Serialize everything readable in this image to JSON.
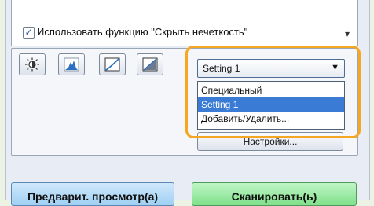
{
  "options": {
    "unsharp_mask_label": "Использовать функцию \"Скрыть нечеткость\"",
    "unsharp_mask_checked": true,
    "check_glyph": "✓",
    "scroll_arrow": "▾"
  },
  "tool_buttons": [
    {
      "icon": "brightness-icon"
    },
    {
      "icon": "histogram-icon"
    },
    {
      "icon": "tone-curve-icon"
    },
    {
      "icon": "final-review-icon"
    }
  ],
  "color_settings": {
    "selected_value": "Setting 1",
    "arrow": "▼",
    "options": [
      "Специальный",
      "Setting 1",
      "Добавить/Удалить..."
    ],
    "highlighted_index": 1,
    "settings_button_label": "Настройки..."
  },
  "actions": {
    "preview_label": "Предварит. просмотр(а)",
    "scan_label": "Сканировать(ь)"
  },
  "colors": {
    "highlight_ring": "#f5a623",
    "selected_item": "#3a7bd5",
    "preview_button": "#9fd0f3",
    "scan_button": "#7fe08a"
  }
}
